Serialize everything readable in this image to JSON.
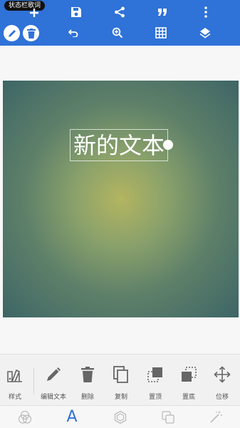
{
  "toolbar": {
    "tooltip": "状态栏歌词",
    "icons_top": [
      "add-icon",
      "save-icon",
      "share-icon",
      "quote-icon",
      "more-vert-icon"
    ],
    "icons_bottom": [
      "undo-icon",
      "zoom-in-icon",
      "grid-icon",
      "layers-icon"
    ],
    "left_buttons": [
      "edit-pencil-icon",
      "delete-icon"
    ],
    "color": "#2f72d8"
  },
  "canvas": {
    "text": "新的文本",
    "gradient_center": "#b3b560",
    "gradient_edge": "#3d6566"
  },
  "actions": [
    {
      "label": "样式",
      "icon": "style-palette-icon"
    },
    {
      "label": "编辑文本",
      "icon": "edit-pencil-icon"
    },
    {
      "label": "删除",
      "icon": "delete-icon"
    },
    {
      "label": "复制",
      "icon": "copy-icon"
    },
    {
      "label": "置顶",
      "icon": "bring-to-front-icon"
    },
    {
      "label": "置底",
      "icon": "send-to-back-icon"
    },
    {
      "label": "位移",
      "icon": "move-arrows-icon"
    }
  ],
  "bottom_tabs": {
    "text_tab_glyph": "A",
    "tabs": [
      "color-filter-icon",
      "text-icon",
      "shape-hexagon-icon",
      "layers-copy-icon",
      "magic-wand-icon"
    ],
    "active": "text-icon"
  }
}
